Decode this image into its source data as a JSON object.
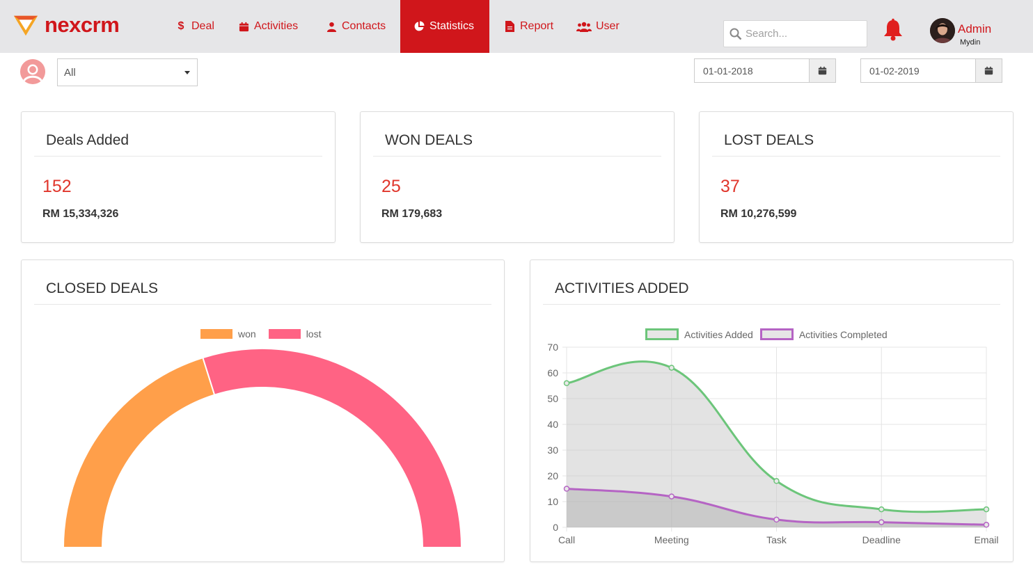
{
  "brand": {
    "name": "nexcrm",
    "accent": "#d0161b"
  },
  "nav": {
    "deal": "Deal",
    "activities": "Activities",
    "contacts": "Contacts",
    "statistics": "Statistics",
    "report": "Report",
    "user": "User"
  },
  "search": {
    "placeholder": "Search..."
  },
  "user": {
    "name": "Admin",
    "sub": "Mydin"
  },
  "filter": {
    "selected": "All",
    "date_from": "01-01-2018",
    "date_to": "01-02-2019"
  },
  "cards": {
    "added": {
      "title": "Deals Added",
      "count": "152",
      "amount": "RM 15,334,326"
    },
    "won": {
      "title": "WON DEALS",
      "count": "25",
      "amount": "RM 179,683"
    },
    "lost": {
      "title": "LOST DEALS",
      "count": "37",
      "amount": "RM 10,276,599"
    }
  },
  "closed": {
    "title": "CLOSED DEALS",
    "legend_won": "won",
    "legend_lost": "lost"
  },
  "activities": {
    "title": "ACTIVITIES ADDED",
    "legend_added": "Activities Added",
    "legend_completed": "Activities Completed"
  },
  "chart_data": [
    {
      "type": "pie",
      "variant": "half-doughnut",
      "categories": [
        "won",
        "lost"
      ],
      "values": [
        25,
        37
      ],
      "colors": [
        "#ff9f4a",
        "#ff6384"
      ]
    },
    {
      "type": "area",
      "categories": [
        "Call",
        "Meeting",
        "Task",
        "Deadline",
        "Email"
      ],
      "ylim": [
        0,
        70
      ],
      "yticks": [
        0,
        10,
        20,
        30,
        40,
        50,
        60,
        70
      ],
      "grid": true,
      "legend": "top",
      "series": [
        {
          "name": "Activities Added",
          "values": [
            56,
            62,
            18,
            7,
            7
          ],
          "color": "#6cc57a"
        },
        {
          "name": "Activities Completed",
          "values": [
            15,
            12,
            3,
            2,
            1
          ],
          "color": "#b564c4"
        }
      ]
    }
  ]
}
